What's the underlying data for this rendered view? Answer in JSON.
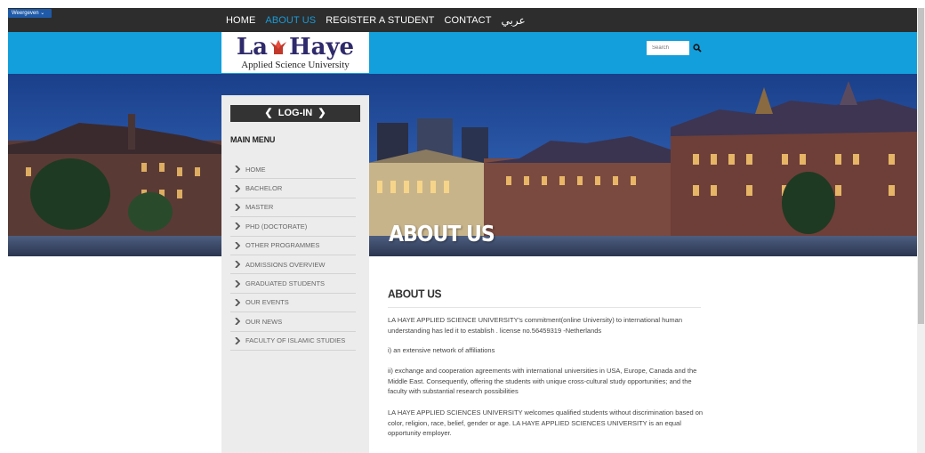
{
  "toolbar": {
    "language_button": "Weergeven"
  },
  "nav": {
    "items": [
      "HOME",
      "ABOUT US",
      "REGISTER A STUDENT",
      "CONTACT",
      "عربي"
    ]
  },
  "logo": {
    "main_left": "La",
    "main_right": "Haye",
    "subtitle": "Applied Science University"
  },
  "search": {
    "placeholder": "Search"
  },
  "banner": {
    "title": "ABOUT US"
  },
  "sidebar": {
    "login_label": "LOG-IN",
    "menu_heading": "MAIN MENU",
    "items": [
      "HOME",
      "BACHELOR",
      "MASTER",
      "PHD (DOCTORATE)",
      "OTHER PROGRAMMES",
      "ADMISSIONS OVERVIEW",
      "GRADUATED STUDENTS",
      "OUR EVENTS",
      "OUR NEWS",
      "FACULTY OF ISLAMIC STUDIES"
    ]
  },
  "content": {
    "heading": "ABOUT US",
    "paragraphs": [
      "LA HAYE APPLIED SCIENCE UNIVERSITY's commitment(online University) to international human understanding has led it to establish . license no.56459319 -Netherlands",
      "i) an extensive network of affiliations",
      "ii) exchange and cooperation agreements with international universities in USA, Europe, Canada and the Middle East. Consequently, offering the students with unique cross-cultural study opportunities; and the faculty with substantial research possibilities",
      "LA HAYE APPLIED SCIENCES UNIVERSITY welcomes qualified students without discrimination based on color, religion, race, belief, gender or age. LA HAYE APPLIED SCIENCES UNIVERSITY is an equal opportunity employer."
    ]
  },
  "colors": {
    "top_bar": "#2d2d2d",
    "accent_blue": "#139fdc",
    "active_nav": "#1a9ad6",
    "sidebar": "#ececec"
  }
}
